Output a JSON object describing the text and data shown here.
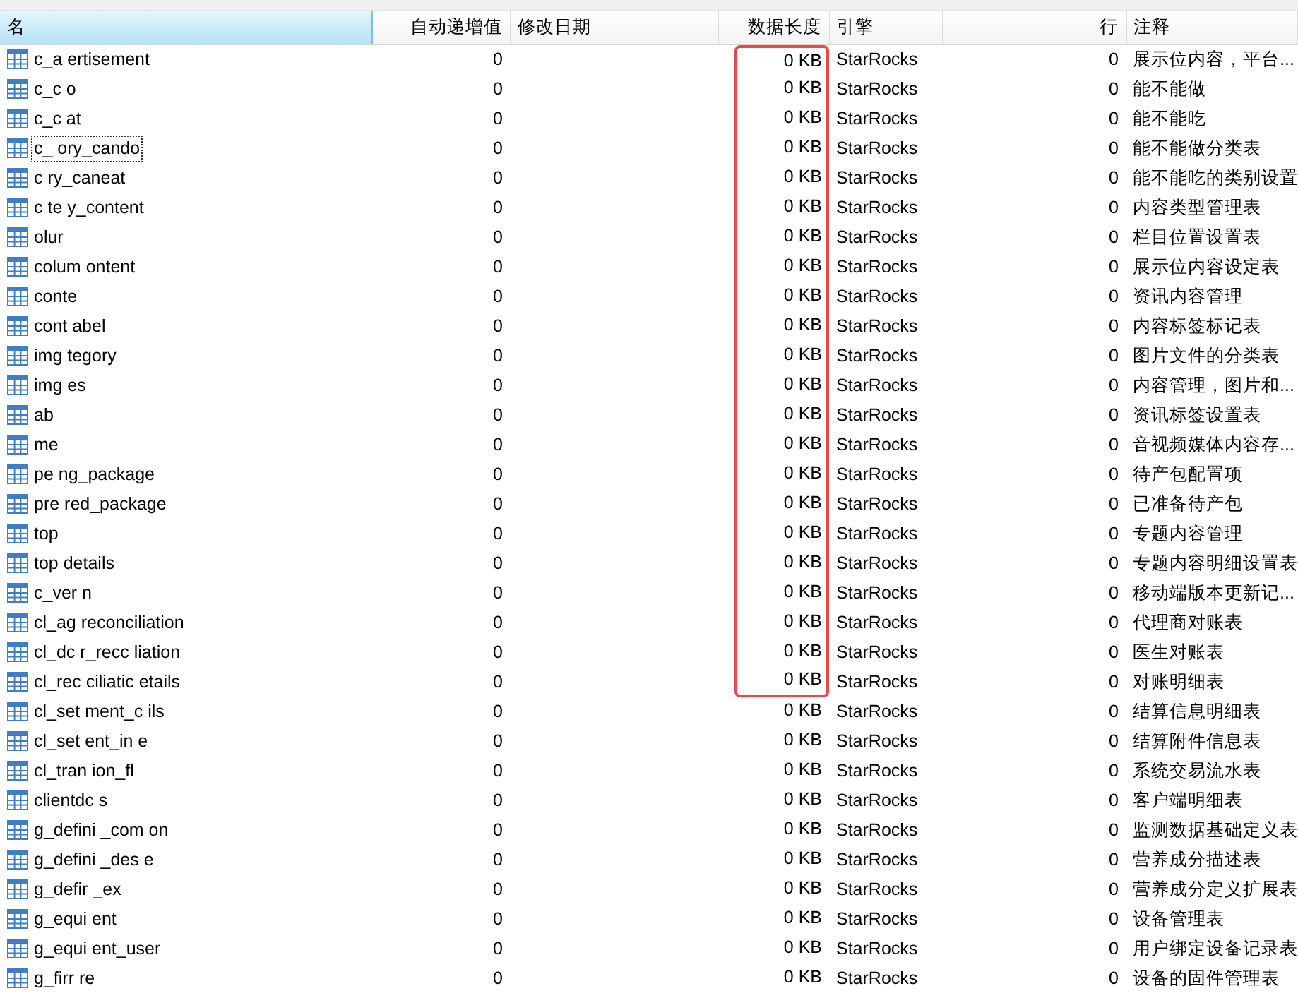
{
  "columns": [
    {
      "label": "名",
      "sorted": true
    },
    {
      "label": "自动递增值",
      "sorted": false
    },
    {
      "label": "修改日期",
      "sorted": false
    },
    {
      "label": "数据长度",
      "sorted": false
    },
    {
      "label": "引擎",
      "sorted": false
    },
    {
      "label": "行",
      "sorted": false
    },
    {
      "label": "注释",
      "sorted": false
    }
  ],
  "rows": [
    {
      "name": "c_a ertisement",
      "auto_increment": "0",
      "data_length": "0 KB",
      "engine": "StarRocks",
      "rows": "0",
      "comment": "展示位内容，平台...",
      "focused": false,
      "highlighted": true
    },
    {
      "name": "c_c o",
      "auto_increment": "0",
      "data_length": "0 KB",
      "engine": "StarRocks",
      "rows": "0",
      "comment": "能不能做",
      "focused": false,
      "highlighted": true
    },
    {
      "name": "c_c at",
      "auto_increment": "0",
      "data_length": "0 KB",
      "engine": "StarRocks",
      "rows": "0",
      "comment": "能不能吃",
      "focused": false,
      "highlighted": true
    },
    {
      "name": "c_ ory_cando",
      "auto_increment": "0",
      "data_length": "0 KB",
      "engine": "StarRocks",
      "rows": "0",
      "comment": "能不能做分类表",
      "focused": true,
      "highlighted": true
    },
    {
      "name": "c ry_caneat",
      "auto_increment": "0",
      "data_length": "0 KB",
      "engine": "StarRocks",
      "rows": "0",
      "comment": "能不能吃的类别设置",
      "focused": false,
      "highlighted": true
    },
    {
      "name": "c te y_content",
      "auto_increment": "0",
      "data_length": "0 KB",
      "engine": "StarRocks",
      "rows": "0",
      "comment": "内容类型管理表",
      "focused": false,
      "highlighted": true
    },
    {
      "name": "olur",
      "auto_increment": "0",
      "data_length": "0 KB",
      "engine": "StarRocks",
      "rows": "0",
      "comment": "栏目位置设置表",
      "focused": false,
      "highlighted": true
    },
    {
      "name": "colum ontent",
      "auto_increment": "0",
      "data_length": "0 KB",
      "engine": "StarRocks",
      "rows": "0",
      "comment": "展示位内容设定表",
      "focused": false,
      "highlighted": true
    },
    {
      "name": "conte",
      "auto_increment": "0",
      "data_length": "0 KB",
      "engine": "StarRocks",
      "rows": "0",
      "comment": "资讯内容管理",
      "focused": false,
      "highlighted": true
    },
    {
      "name": "cont abel",
      "auto_increment": "0",
      "data_length": "0 KB",
      "engine": "StarRocks",
      "rows": "0",
      "comment": "内容标签标记表",
      "focused": false,
      "highlighted": true
    },
    {
      "name": "img tegory",
      "auto_increment": "0",
      "data_length": "0 KB",
      "engine": "StarRocks",
      "rows": "0",
      "comment": "图片文件的分类表",
      "focused": false,
      "highlighted": true
    },
    {
      "name": "img es",
      "auto_increment": "0",
      "data_length": "0 KB",
      "engine": "StarRocks",
      "rows": "0",
      "comment": "内容管理，图片和...",
      "focused": false,
      "highlighted": true
    },
    {
      "name": "ab",
      "auto_increment": "0",
      "data_length": "0 KB",
      "engine": "StarRocks",
      "rows": "0",
      "comment": "资讯标签设置表",
      "focused": false,
      "highlighted": true
    },
    {
      "name": "me",
      "auto_increment": "0",
      "data_length": "0 KB",
      "engine": "StarRocks",
      "rows": "0",
      "comment": "音视频媒体内容存...",
      "focused": false,
      "highlighted": true
    },
    {
      "name": "pe ng_package",
      "auto_increment": "0",
      "data_length": "0 KB",
      "engine": "StarRocks",
      "rows": "0",
      "comment": "待产包配置项",
      "focused": false,
      "highlighted": true
    },
    {
      "name": "pre red_package",
      "auto_increment": "0",
      "data_length": "0 KB",
      "engine": "StarRocks",
      "rows": "0",
      "comment": "已准备待产包",
      "focused": false,
      "highlighted": true
    },
    {
      "name": "top",
      "auto_increment": "0",
      "data_length": "0 KB",
      "engine": "StarRocks",
      "rows": "0",
      "comment": "专题内容管理",
      "focused": false,
      "highlighted": true
    },
    {
      "name": "top details",
      "auto_increment": "0",
      "data_length": "0 KB",
      "engine": "StarRocks",
      "rows": "0",
      "comment": "专题内容明细设置表",
      "focused": false,
      "highlighted": true
    },
    {
      "name": "c_ver n",
      "auto_increment": "0",
      "data_length": "0 KB",
      "engine": "StarRocks",
      "rows": "0",
      "comment": "移动端版本更新记...",
      "focused": false,
      "highlighted": true
    },
    {
      "name": "cl_ag reconciliation",
      "auto_increment": "0",
      "data_length": "0 KB",
      "engine": "StarRocks",
      "rows": "0",
      "comment": "代理商对账表",
      "focused": false,
      "highlighted": true
    },
    {
      "name": "cl_dc r_recc liation",
      "auto_increment": "0",
      "data_length": "0 KB",
      "engine": "StarRocks",
      "rows": "0",
      "comment": "医生对账表",
      "focused": false,
      "highlighted": true
    },
    {
      "name": "cl_rec ciliatic etails",
      "auto_increment": "0",
      "data_length": "0 KB",
      "engine": "StarRocks",
      "rows": "0",
      "comment": "对账明细表",
      "focused": false,
      "highlighted": true
    },
    {
      "name": "cl_set ment_c ils",
      "auto_increment": "0",
      "data_length": "0 KB",
      "engine": "StarRocks",
      "rows": "0",
      "comment": "结算信息明细表",
      "focused": false,
      "highlighted": false
    },
    {
      "name": "cl_set ent_in e",
      "auto_increment": "0",
      "data_length": "0 KB",
      "engine": "StarRocks",
      "rows": "0",
      "comment": "结算附件信息表",
      "focused": false,
      "highlighted": false
    },
    {
      "name": "cl_tran ion_fl",
      "auto_increment": "0",
      "data_length": "0 KB",
      "engine": "StarRocks",
      "rows": "0",
      "comment": "系统交易流水表",
      "focused": false,
      "highlighted": false
    },
    {
      "name": "clientdc s",
      "auto_increment": "0",
      "data_length": "0 KB",
      "engine": "StarRocks",
      "rows": "0",
      "comment": "客户端明细表",
      "focused": false,
      "highlighted": false
    },
    {
      "name": "g_defini _com on",
      "auto_increment": "0",
      "data_length": "0 KB",
      "engine": "StarRocks",
      "rows": "0",
      "comment": "监测数据基础定义表",
      "focused": false,
      "highlighted": false
    },
    {
      "name": "g_defini _des e",
      "auto_increment": "0",
      "data_length": "0 KB",
      "engine": "StarRocks",
      "rows": "0",
      "comment": "营养成分描述表",
      "focused": false,
      "highlighted": false
    },
    {
      "name": "g_defir _ex",
      "auto_increment": "0",
      "data_length": "0 KB",
      "engine": "StarRocks",
      "rows": "0",
      "comment": "营养成分定义扩展表",
      "focused": false,
      "highlighted": false
    },
    {
      "name": "g_equi ent",
      "auto_increment": "0",
      "data_length": "0 KB",
      "engine": "StarRocks",
      "rows": "0",
      "comment": "设备管理表",
      "focused": false,
      "highlighted": false
    },
    {
      "name": "g_equi ent_user",
      "auto_increment": "0",
      "data_length": "0 KB",
      "engine": "StarRocks",
      "rows": "0",
      "comment": "用户绑定设备记录表",
      "focused": false,
      "highlighted": false
    },
    {
      "name": "g_firr re",
      "auto_increment": "0",
      "data_length": "0 KB",
      "engine": "StarRocks",
      "rows": "0",
      "comment": "设备的固件管理表",
      "focused": false,
      "highlighted": false
    }
  ]
}
